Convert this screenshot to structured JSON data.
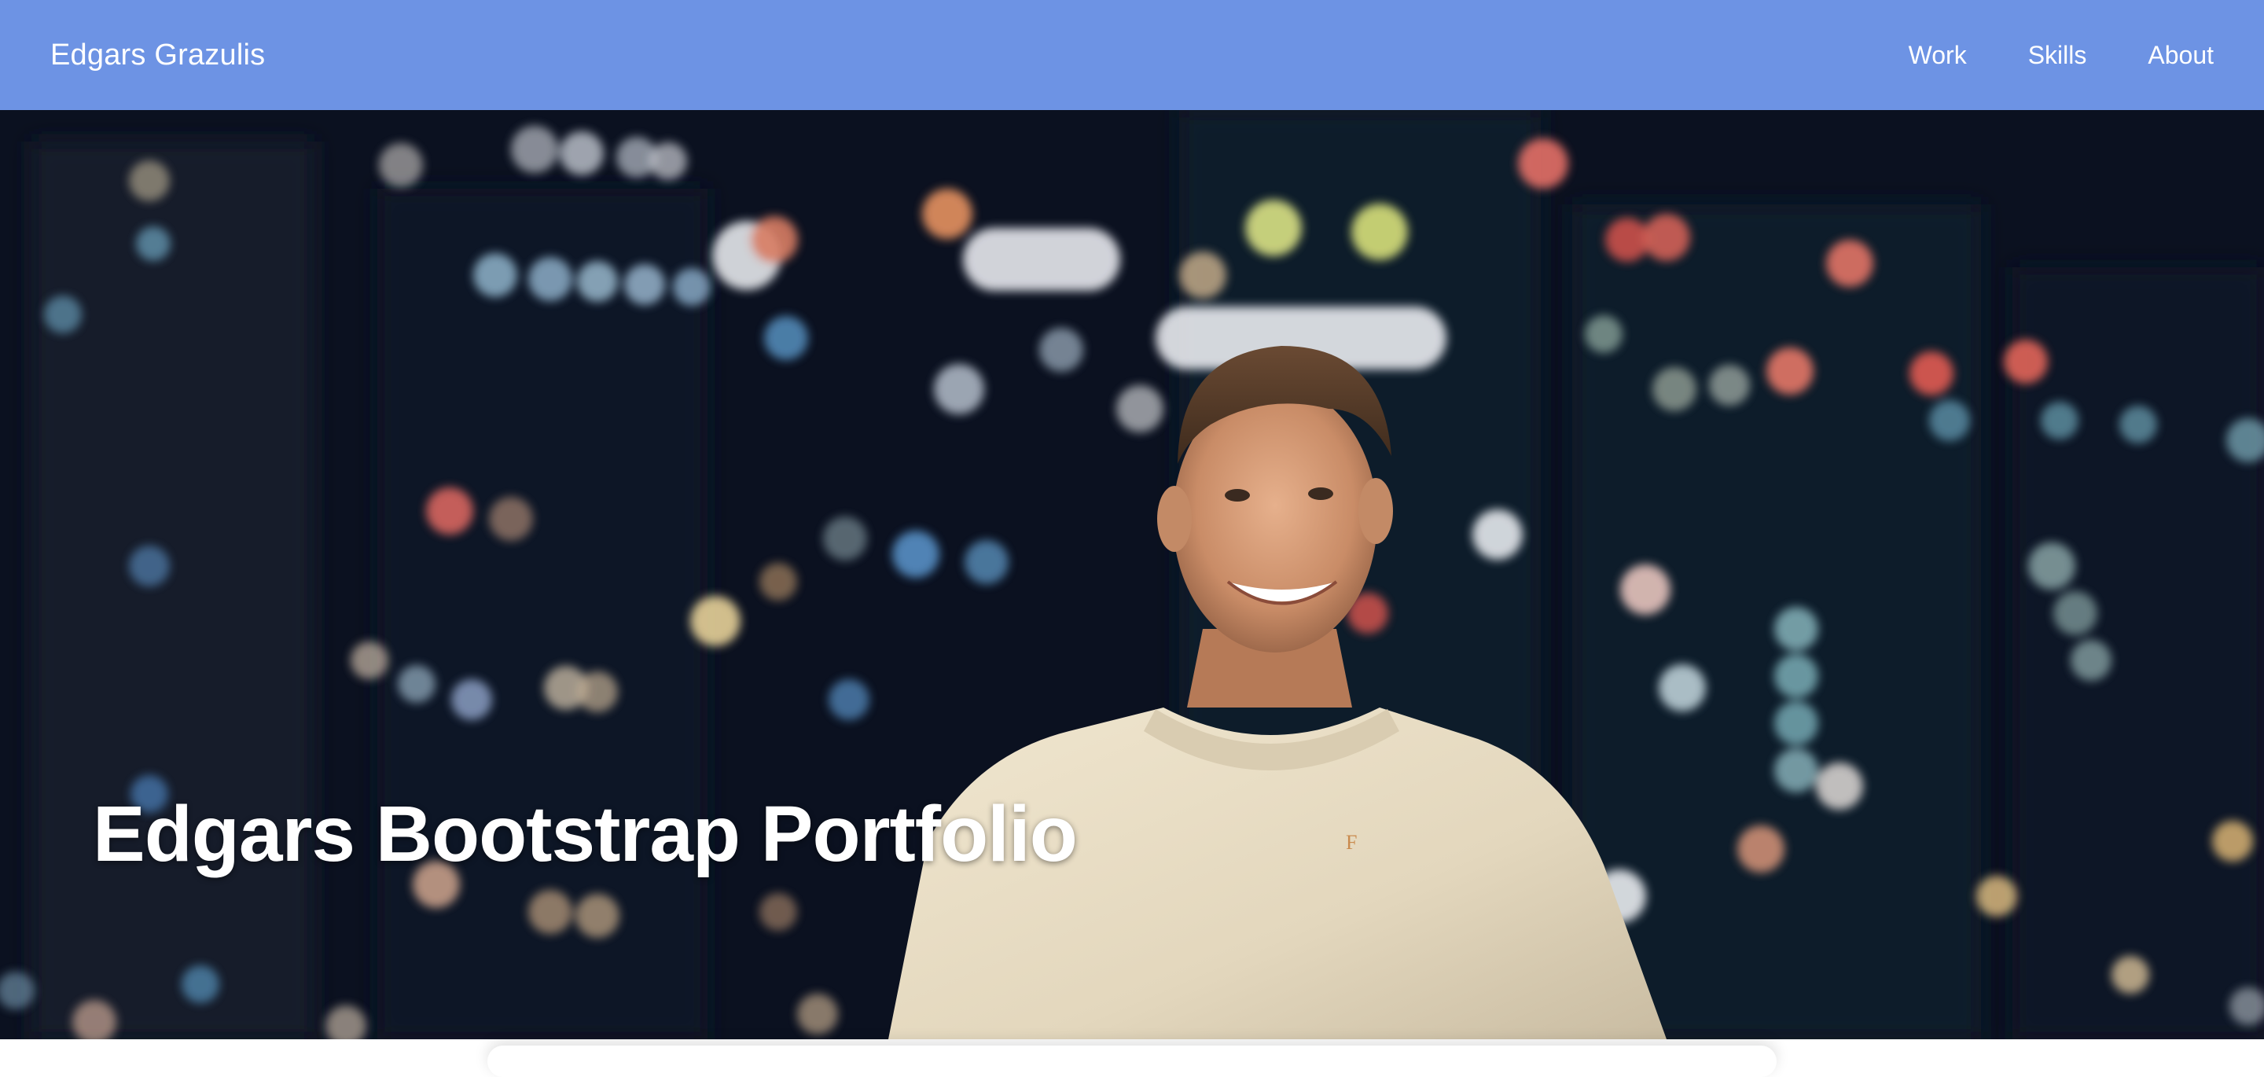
{
  "navbar": {
    "brand": "Edgars Grazulis",
    "links": [
      {
        "label": "Work"
      },
      {
        "label": "Skills"
      },
      {
        "label": "About"
      }
    ],
    "background_color": "#6d93e4"
  },
  "hero": {
    "title": "Edgars Bootstrap Portfolio",
    "image": "portrait-photo-night-city-bokeh"
  }
}
